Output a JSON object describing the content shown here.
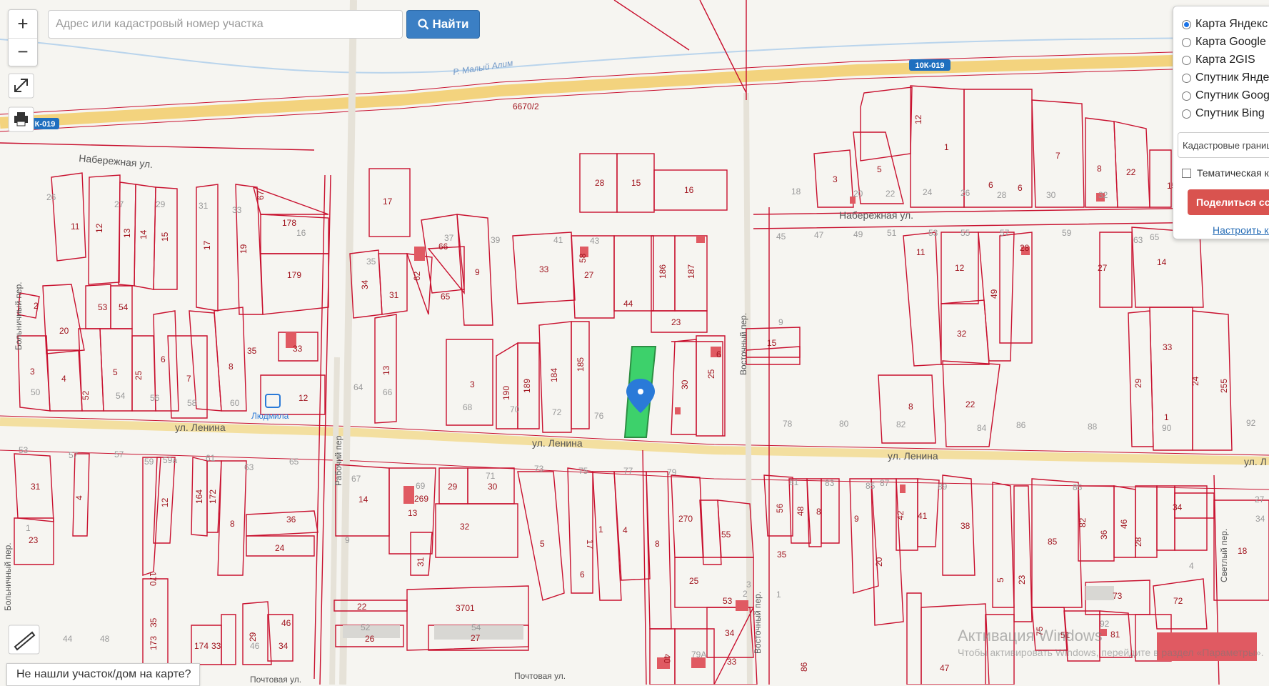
{
  "search": {
    "placeholder": "Адрес или кадастровый номер участка",
    "value": "",
    "button_label": "Найти"
  },
  "zoom": {
    "in_label": "+",
    "out_label": "−"
  },
  "layers": {
    "options": [
      {
        "label": "Карта Яндекс",
        "selected": true
      },
      {
        "label": "Карта Google",
        "selected": false
      },
      {
        "label": "Карта 2GIS",
        "selected": false
      },
      {
        "label": "Спутник Яндекс",
        "selected": false
      },
      {
        "label": "Спутник Google",
        "selected": false
      },
      {
        "label": "Спутник Bing",
        "selected": false
      }
    ],
    "cadastral_select": "Кадастровые границы",
    "thematic_label": "Тематическая карта",
    "share_label": "Поделиться ссылкой",
    "configure_link": "Настроить карту"
  },
  "not_found": "Не нашли участок/дом на карте?",
  "watermark": {
    "line1": "Активация Windows",
    "line2": "Чтобы активировать Windows, перейдите в раздел «Параметры»."
  },
  "map": {
    "streets": {
      "naberezhnaya_left": "Набережная ул.",
      "naberezhnaya_right": "Набережная ул.",
      "lenina_1": "ул. Ленина",
      "lenina_2": "ул. Ленина",
      "lenina_3": "ул. Ленина",
      "lenina_4": "ул. Л",
      "bolnichny_1": "Больничный пер.",
      "bolnichny_2": "Больничный пер.",
      "rabochy": "Рабочий пер",
      "vostochny_1": "Восточный пер.",
      "vostochny_2": "Восточный пер.",
      "svetly": "Светлый пер.",
      "pochtovaya_1": "Почтовая ул.",
      "pochtovaya_2": "Почтовая ул.",
      "river": "Р. Малый Алим"
    },
    "road_badges": {
      "east": "10К-019",
      "west": "К-019"
    },
    "road_number": "6670/2",
    "poi": "Людмила",
    "labels": {
      "p28": "28",
      "p15": "15",
      "p16": "16",
      "p17": "17",
      "p11": "11",
      "p12": "12",
      "p13": "13",
      "p14": "14",
      "p15b": "15",
      "p17b": "17",
      "p19": "19",
      "p67": "67",
      "p178": "178",
      "p179": "179",
      "p66": "66",
      "p62": "62",
      "p65": "65",
      "p9": "9",
      "p33": "33",
      "p58": "58",
      "p27": "27",
      "p44": "44",
      "p186": "186",
      "p187": "187",
      "p23": "23",
      "p34": "34",
      "p31": "31",
      "p2": "2",
      "p20": "20",
      "p53": "53",
      "p54": "54",
      "p8": "8",
      "p35": "35",
      "p33b": "33",
      "p3": "3",
      "p4": "4",
      "p5": "5",
      "p25": "25",
      "p6": "6",
      "p7": "7",
      "p52": "52",
      "p12b": "12",
      "p13b": "13",
      "p3b": "3",
      "p190": "190",
      "p189": "189",
      "p184": "184",
      "p185": "185",
      "p30": "30",
      "p25b": "25",
      "p6b": "6",
      "p15c": "15",
      "p3c": "3",
      "p5b": "5",
      "p12c": "12",
      "p1": "1",
      "p7b": "7",
      "p6c": "6",
      "p6d": "6",
      "p8b": "8",
      "p22": "22",
      "p15d": "15",
      "p11b": "11",
      "p12d": "12",
      "p49": "49",
      "p28b": "28",
      "p27b": "27",
      "p14b": "14",
      "p32": "32",
      "p8c": "8",
      "p22b": "22",
      "p33c": "33",
      "p29": "29",
      "p24": "24",
      "p255": "255",
      "p1b": "1",
      "p31b": "31",
      "p23b": "23",
      "p4b": "4",
      "p12e": "12",
      "p170": "170",
      "p164": "164",
      "p172": "172",
      "p8d": "8",
      "p36": "36",
      "p24b": "24",
      "p14c": "14",
      "p269": "269",
      "p13c": "13",
      "p29b": "29",
      "p30b": "30",
      "p32b": "32",
      "p31c": "31",
      "p5c": "5",
      "p1c": "1",
      "p17c": "17",
      "p4c": "4",
      "p6e": "6",
      "p8e": "8",
      "p270": "270",
      "p55": "55",
      "p25c": "25",
      "p53b": "53",
      "p34b": "34",
      "p33d": "33",
      "p35b": "35",
      "p56": "56",
      "p48": "48",
      "p8f": "8",
      "p9b": "9",
      "p20b": "20",
      "p42": "42",
      "p41": "41",
      "p38": "38",
      "p5d": "5",
      "p23c": "23",
      "p85": "85",
      "p82": "82",
      "p36b": "36",
      "p46": "46",
      "p28c": "28",
      "p34c": "34",
      "p18": "18",
      "p73": "73",
      "p72": "72",
      "p81": "81",
      "p75": "75",
      "p51": "51",
      "p47": "47",
      "p22c": "22",
      "p3701": "3701",
      "p26": "26",
      "p27c": "27",
      "p173": "173",
      "p35c": "35",
      "p174": "174",
      "p33e": "33",
      "p29c": "29",
      "p34d": "34",
      "p46b": "46",
      "p40": "40",
      "p86": "86",
      "p46c": "46"
    },
    "gray_labels": {
      "g26": "26",
      "g27": "27",
      "g29": "29",
      "g31": "31",
      "g33": "33",
      "g16": "16",
      "g37": "37",
      "g35": "35",
      "g39": "39",
      "g41": "41",
      "g43": "43",
      "g45": "45",
      "g47": "47",
      "g49": "49",
      "g51": "51",
      "g53": "53",
      "g55": "55",
      "g57": "57",
      "g59": "59",
      "g63": "63",
      "g65": "65",
      "g18": "18",
      "g20": "20",
      "g22": "22",
      "g24": "24",
      "g26b": "26",
      "g28": "28",
      "g30": "30",
      "g32": "32",
      "g50": "50",
      "g54": "54",
      "g56": "56",
      "g58": "58",
      "g60": "60",
      "g64": "64",
      "g66": "66",
      "g68": "68",
      "g70": "70",
      "g72": "72",
      "g76": "76",
      "g78": "78",
      "g80": "80",
      "g82": "82",
      "g84": "84",
      "g86": "86",
      "g88": "88",
      "g90": "90",
      "g92": "92",
      "g9": "9",
      "g53b": "53",
      "g57b": "57",
      "g59b": "59",
      "g59a": "59а",
      "g61": "61",
      "g63b": "63",
      "g65b": "65",
      "g67": "67",
      "g69": "69",
      "g71": "71",
      "g73": "73",
      "g75": "75",
      "g77": "77",
      "g79": "79",
      "g81": "81",
      "g83": "83",
      "g85": "85",
      "g87": "87",
      "g89": "89",
      "g1": "1",
      "g9b": "9",
      "g79a": "79А",
      "g52": "52",
      "g54b": "54",
      "g48": "48",
      "g44": "44",
      "g46": "46",
      "g4": "4",
      "g1b": "1",
      "g27b": "27",
      "g3": "3",
      "g2": "2",
      "g92b": "92",
      "g85b": "85",
      "g34": "34"
    }
  }
}
